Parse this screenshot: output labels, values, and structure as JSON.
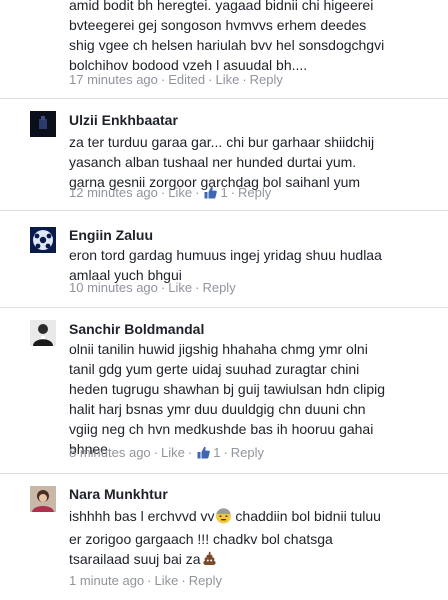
{
  "comments": [
    {
      "lines": [
        "amid bodit bh heregtei. yagaad bidnii chi higeerei",
        "bvteegerei gej songoson hvmvvs erhem deedes",
        "shig vgee ch helsen hariulah bvv hel sonsdogchgvi",
        "bolchihov bodood vzeh l asuudal bh...."
      ],
      "time": "17 minutes ago",
      "edited": "Edited",
      "like": "Like",
      "reply": "Reply"
    },
    {
      "name": "Ulzii Enkhbaatar",
      "lines": [
        "za ter turduu garaa gar... chi bur garhaar shiidchij",
        "yasanch alban tushaal ner hunded durtai yum.",
        "garna gesnii zorgoor garchdag bol saihanl yum"
      ],
      "time": "12 minutes ago",
      "like": "Like",
      "like_count": "1",
      "reply": "Reply"
    },
    {
      "name": "Engiin Zaluu",
      "lines": [
        "eron tord gardag humuus ingej yridag shuu hudlaa",
        "amlaal yuch bhgui"
      ],
      "time": "10 minutes ago",
      "like": "Like",
      "reply": "Reply"
    },
    {
      "name": "Sanchir Boldmandal",
      "lines": [
        "olnii tanilin huwid jigshig hhahaha chmg ymr olni",
        "tanil gdg yum gerte uidaj suuhad zuragtar chini",
        "heden tugrugu shawhan bj guij tawiulsan hdn clipig",
        "halit harj bsnas ymr duu duuldgig chn duuni chn",
        "vgiig neg ch hvn medkushde bas ih hooruu gahai",
        "bhnee"
      ],
      "time": "8 minutes ago",
      "like": "Like",
      "like_count": "1",
      "reply": "Reply"
    },
    {
      "name": "Nara Munkhtur",
      "lines": [
        "ishhhh bas l erchvvd vv",
        "chaddiin bol bidnii tuluu",
        "er zorigoo gargaach !!! chadkv bol chatsga",
        "tsarailaad suuj bai za"
      ],
      "time": "1 minute ago",
      "like": "Like",
      "reply": "Reply"
    }
  ],
  "colors": {
    "text": "#1d2129",
    "meta": "#90949c",
    "divider": "#dcdee3",
    "like_blue": "#4267b2"
  },
  "icons": [
    "thumbs-up-icon",
    "cold-sweat-emoji",
    "poop-emoji"
  ]
}
